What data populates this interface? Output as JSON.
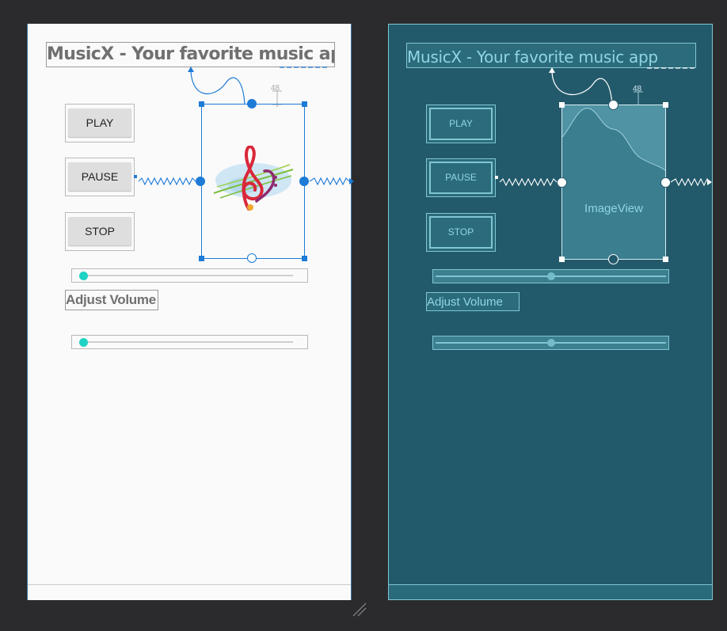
{
  "design": {
    "title": "MusicX - Your favorite music app",
    "buttons": {
      "play": "PLAY",
      "pause": "PAUSE",
      "stop": "STOP"
    },
    "adjust_volume": "Adjust Volume",
    "margin_label": "48",
    "seekbar_progress": 0,
    "volume_progress": 0
  },
  "blueprint": {
    "title": "MusicX - Your favorite music app",
    "buttons": {
      "play": "PLAY",
      "pause": "PAUSE",
      "stop": "STOP"
    },
    "adjust_volume": "Adjust Volume",
    "imageview_label": "ImageView",
    "margin_label": "48",
    "seekbar_progress": 0.5,
    "volume_progress": 0.5
  },
  "colors": {
    "editor_bg": "#2b2b2d",
    "design_bg": "#fafafa",
    "blueprint_bg": "#235a6b",
    "selection_blue": "#1e7bd6",
    "seek_thumb": "#1fd3c4",
    "blueprint_line": "#7fc6d3"
  },
  "icons": {
    "image_content": "music-note-treble-clef-icon",
    "constraint_spring": "zigzag-constraint-icon",
    "resize": "resize-grip-icon"
  }
}
